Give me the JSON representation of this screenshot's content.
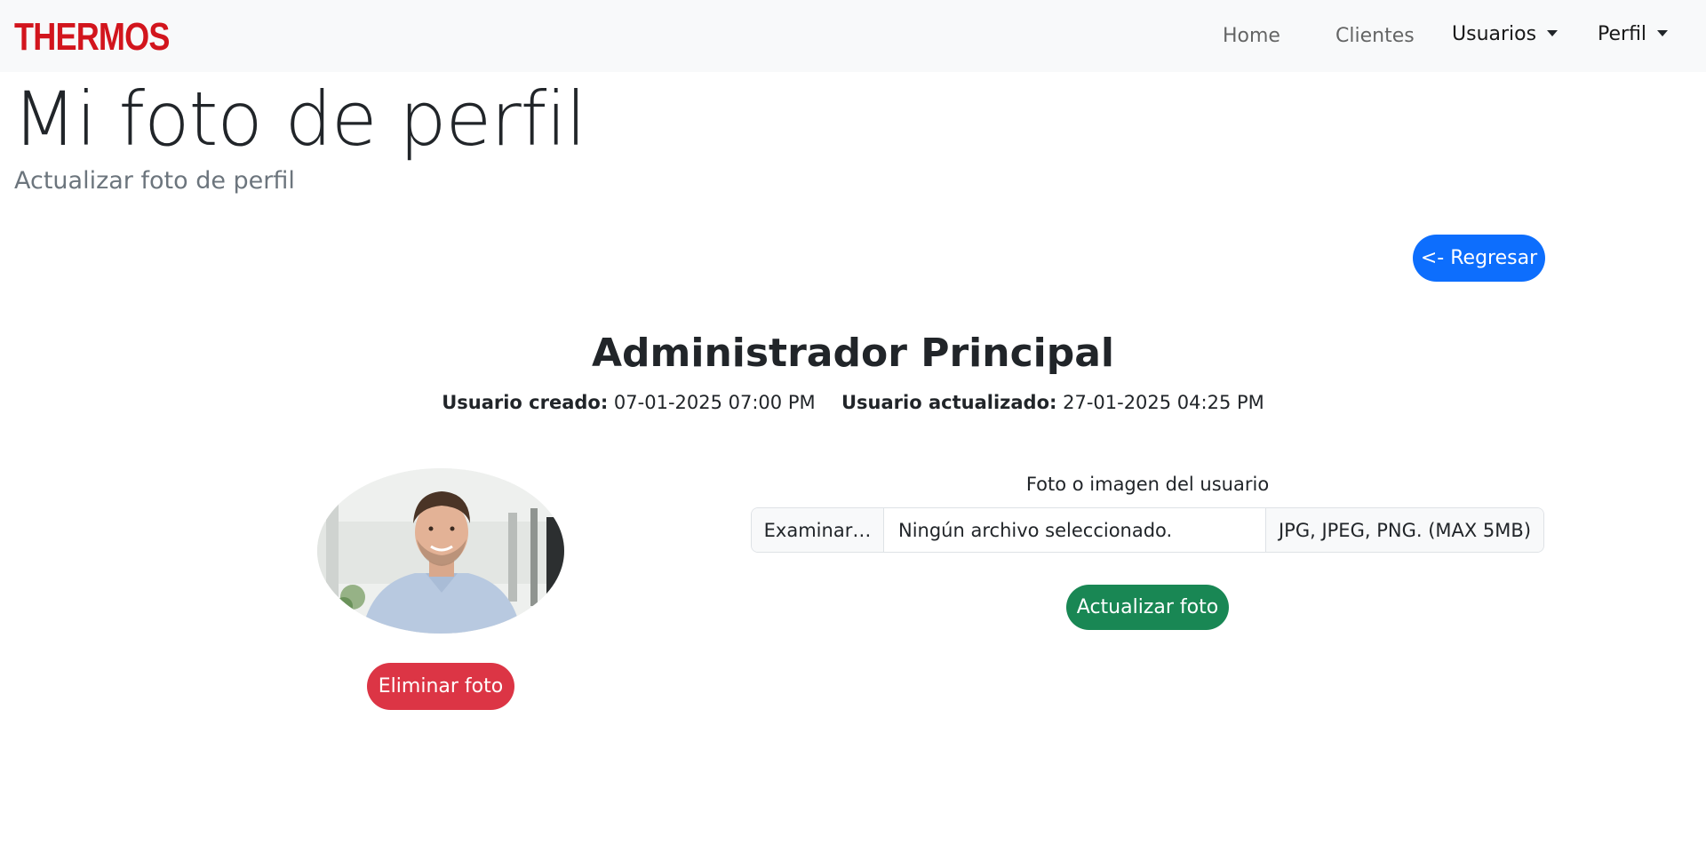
{
  "navbar": {
    "brand": "THERMOS",
    "links": [
      {
        "label": "Home"
      },
      {
        "label": "Clientes"
      }
    ],
    "dropdowns": [
      {
        "label": "Usuarios"
      },
      {
        "label": "Perfil"
      }
    ]
  },
  "page": {
    "title": "Mi foto de perfil",
    "subtitle": "Actualizar foto de perfil"
  },
  "back_button": {
    "label": "<- Regresar"
  },
  "user": {
    "name": "Administrador Principal",
    "created_label": "Usuario creado:",
    "created_value": "07-01-2025 07:00 PM",
    "updated_label": "Usuario actualizado:",
    "updated_value": "27-01-2025 04:25 PM"
  },
  "avatar": {
    "icon": "profile-photo"
  },
  "delete_button": {
    "label": "Eliminar foto"
  },
  "upload": {
    "label": "Foto o imagen del usuario",
    "browse_label": "Examinar…",
    "file_status": "Ningún archivo seleccionado.",
    "hint": "JPG, JPEG, PNG. (MAX 5MB)"
  },
  "update_button": {
    "label": "Actualizar foto"
  },
  "colors": {
    "brand": "#d2151d",
    "primary": "#0d6efd",
    "success": "#198754",
    "danger": "#dc3545",
    "navbar_bg": "#f8f9fa"
  }
}
